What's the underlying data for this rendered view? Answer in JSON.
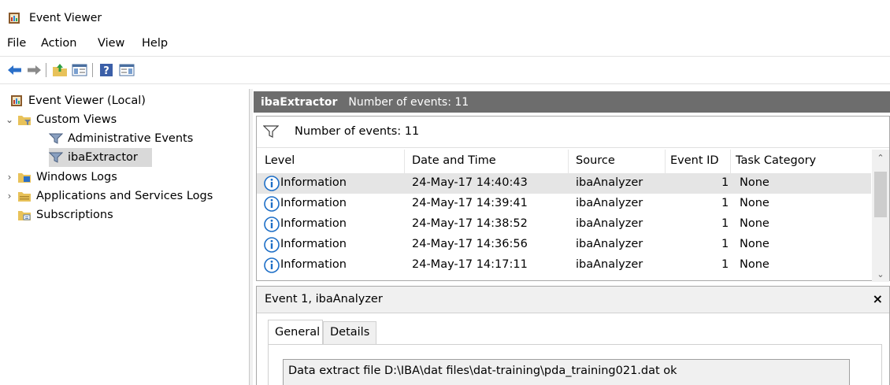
{
  "window": {
    "title": "Event Viewer"
  },
  "menu": {
    "items": [
      "File",
      "Action",
      "View",
      "Help"
    ]
  },
  "toolbar": {
    "buttons": [
      "back-icon",
      "forward-icon",
      "up-folder-icon",
      "show-hide-console-tree-icon",
      "help-icon",
      "show-hide-action-pane-icon"
    ]
  },
  "tree": {
    "root": "Event Viewer (Local)",
    "custom_views": "Custom Views",
    "administrative_events": "Administrative Events",
    "ibaextractor": "ibaExtractor",
    "windows_logs": "Windows Logs",
    "apps_services_logs": "Applications and Services Logs",
    "subscriptions": "Subscriptions"
  },
  "header": {
    "name": "ibaExtractor",
    "count": "Number of events: 11"
  },
  "filter": {
    "text": "Number of events: 11"
  },
  "columns": {
    "level": "Level",
    "date_time": "Date and Time",
    "source": "Source",
    "event_id": "Event ID",
    "task_category": "Task Category"
  },
  "events": [
    {
      "level": "Information",
      "date": "24-May-17 14:40:43",
      "source": "ibaAnalyzer",
      "id": "1",
      "task": "None"
    },
    {
      "level": "Information",
      "date": "24-May-17 14:39:41",
      "source": "ibaAnalyzer",
      "id": "1",
      "task": "None"
    },
    {
      "level": "Information",
      "date": "24-May-17 14:38:52",
      "source": "ibaAnalyzer",
      "id": "1",
      "task": "None"
    },
    {
      "level": "Information",
      "date": "24-May-17 14:36:56",
      "source": "ibaAnalyzer",
      "id": "1",
      "task": "None"
    },
    {
      "level": "Information",
      "date": "24-May-17 14:17:11",
      "source": "ibaAnalyzer",
      "id": "1",
      "task": "None"
    }
  ],
  "detail": {
    "title": "Event 1, ibaAnalyzer",
    "close": "×",
    "tabs": [
      "General",
      "Details"
    ],
    "description": "Data extract file D:\\IBA\\dat files\\dat-training\\pda_training021.dat ok"
  },
  "colors": {
    "header_bar": "#6d6d6d",
    "selected_row": "#e5e5e5",
    "info_blue": "#1e6fc7"
  }
}
